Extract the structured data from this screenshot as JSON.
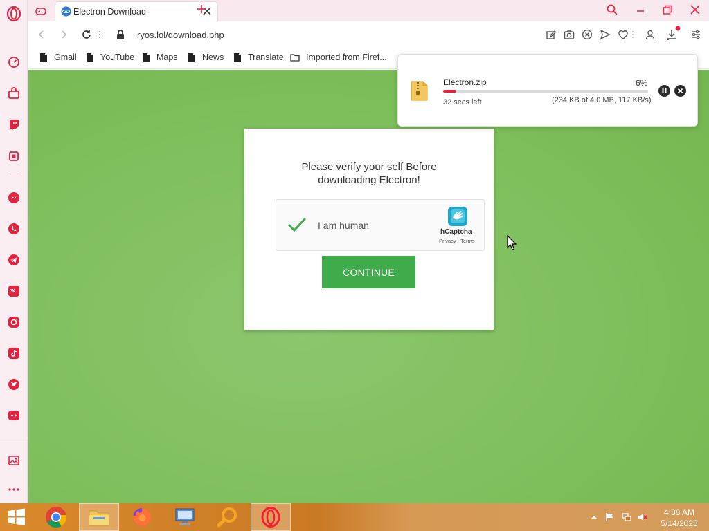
{
  "tab": {
    "title": "Electron Download"
  },
  "address": {
    "url": "ryos.lol/download.php"
  },
  "bookmarks": [
    {
      "label": "Gmail"
    },
    {
      "label": "YouTube"
    },
    {
      "label": "Maps"
    },
    {
      "label": "News"
    },
    {
      "label": "Translate"
    },
    {
      "label": "Imported from Firef..."
    }
  ],
  "download": {
    "filename": "Electron.zip",
    "percent_label": "6%",
    "progress": 0.06,
    "time_left": "32 secs left",
    "size_info": "(234 KB of 4.0 MB, 117 KB/s)"
  },
  "page": {
    "heading_line1": "Please verify your self Before",
    "heading_line2": "downloading Electron!",
    "captcha_label": "I am human",
    "captcha_brand": "hCaptcha",
    "captcha_links": "Privacy - Terms",
    "continue_label": "CONTINUE"
  },
  "taskbar": {
    "time": "4:38 AM",
    "date": "5/14/2023"
  },
  "colors": {
    "accent": "#e2223f",
    "page_bg": "#7fbf5c",
    "button": "#3fab4a"
  }
}
